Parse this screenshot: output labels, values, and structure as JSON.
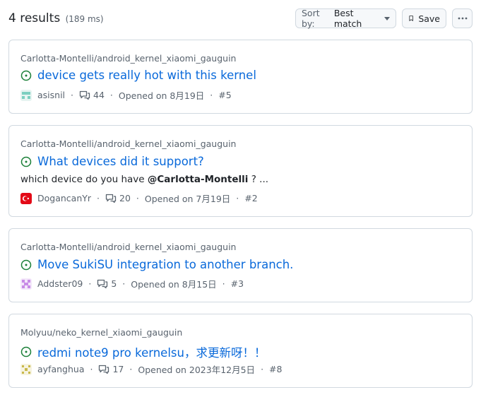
{
  "header": {
    "results_label": "4 results",
    "timing": "(189 ms)",
    "sort_prefix": "Sort by:",
    "sort_value": "Best match",
    "save_label": "Save"
  },
  "results": [
    {
      "repo": "Carlotta-Montelli/android_kernel_xiaomi_gauguin",
      "title": "device gets really hot with this kernel",
      "author": "asisnil",
      "comments": "44",
      "opened": "Opened on 8月19日",
      "number": "#5"
    },
    {
      "repo": "Carlotta-Montelli/android_kernel_xiaomi_gauguin",
      "title": "What devices did it support?",
      "snippet_pre": "which device do you have ",
      "snippet_mention": "@Carlotta-Montelli",
      "snippet_post": " ? ...",
      "author": "DogancanYr",
      "comments": "20",
      "opened": "Opened on 7月19日",
      "number": "#2"
    },
    {
      "repo": "Carlotta-Montelli/android_kernel_xiaomi_gauguin",
      "title": "Move SukiSU integration to another branch.",
      "author": "Addster09",
      "comments": "5",
      "opened": "Opened on 8月15日",
      "number": "#3"
    },
    {
      "repo": "Molyuu/neko_kernel_xiaomi_gauguin",
      "title": "redmi note9 pro kernelsu，求更新呀！！",
      "author": "ayfanghua",
      "comments": "17",
      "opened": "Opened on 2023年12月5日",
      "number": "#8"
    }
  ],
  "colors": {
    "link": "#0969da",
    "open_issue": "#1a7f37",
    "muted": "#59636e",
    "border": "#d1d9e0"
  },
  "icons": {
    "issue": "issue-opened-icon",
    "comment": "comment-icon",
    "bookmark": "bookmark-icon",
    "more": "kebab-horizontal-icon"
  }
}
